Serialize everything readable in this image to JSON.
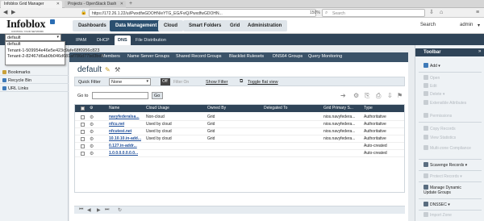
{
  "browser": {
    "tabs": [
      {
        "label": "Infoblox Grid Manager"
      },
      {
        "label": "Projects - OpenStack Dash"
      }
    ],
    "url": "https://172.26.1.22/ui/PwxdfwGDOHN/eYTG_EG/FviQ/PwxdfwGDOHN...",
    "zoom": "150%",
    "search_placeholder": "Search"
  },
  "app": {
    "logo": "Infoblox",
    "logo_tagline": "CONTROL YOUR NETWORK",
    "main_tabs": [
      "Dashboards",
      "Data Management",
      "Cloud",
      "Smart Folders",
      "Grid",
      "Administration"
    ],
    "active_main_tab": "Data Management",
    "search_label": "Search",
    "user_label": "admin"
  },
  "subnav": {
    "tabs": [
      "IPAM",
      "DHCP",
      "DNS",
      "File Distribution"
    ],
    "active": "DNS"
  },
  "subnav2": {
    "tabs": [
      "Members",
      "Name Server Groups",
      "Shared Record Groups",
      "Blacklist Rulesets",
      "DNS64 Groups",
      "Query Monitoring"
    ]
  },
  "view_dropdown": {
    "selected": "default",
    "options": [
      "default",
      "Tenant-1-509954e46e5e423c9afe68f0956c823",
      "Tenant-2-82467d6ab0b046d681af786d77bd3bd5"
    ]
  },
  "left_panel": {
    "items": [
      "Bookmarks",
      "Recycle Bin",
      "URL Links"
    ]
  },
  "content": {
    "breadcrumb": "default",
    "quick_filter_label": "Quick Filter",
    "quick_filter_value": "None",
    "filter_off": "Off",
    "filter_on": "Filter On",
    "show_filter": "Show Filter",
    "toggle_flat": "Toggle flat view",
    "go_to_label": "Go to",
    "go_button": "Go"
  },
  "grid": {
    "columns": [
      "Name",
      "Cloud Usage",
      "Owned By",
      "Delegated To",
      "Grid Primary S...",
      "Type"
    ],
    "rows": [
      {
        "name": "navyfederalsa...",
        "cloud_usage": "Non-cloud",
        "owned_by": "Grid",
        "delegated_to": "",
        "grid_primary": "nios.navyfedera...",
        "type": "Authoritative"
      },
      {
        "name": "nfcu.net",
        "cloud_usage": "Used by cloud",
        "owned_by": "Grid",
        "delegated_to": "",
        "grid_primary": "nios.navyfedera...",
        "type": "Authoritative"
      },
      {
        "name": "nfcutest.net",
        "cloud_usage": "Used by cloud",
        "owned_by": "Grid",
        "delegated_to": "",
        "grid_primary": "nios.navyfedera...",
        "type": "Authoritative"
      },
      {
        "name": "10.10.10.in-add...",
        "cloud_usage": "Used by cloud",
        "owned_by": "Grid",
        "delegated_to": "",
        "grid_primary": "nios.navyfedera...",
        "type": "Authoritative"
      },
      {
        "name": "0.127.in-addr...",
        "cloud_usage": "",
        "owned_by": "",
        "delegated_to": "",
        "grid_primary": "",
        "type": "Auto-created"
      },
      {
        "name": "1.0.0.0.0.0.0.0...",
        "cloud_usage": "",
        "owned_by": "",
        "delegated_to": "",
        "grid_primary": "",
        "type": "Auto-created"
      }
    ]
  },
  "toolbar": {
    "title": "Toolbar",
    "items": [
      {
        "label": "Add",
        "enabled": true
      },
      {
        "label": "Open",
        "enabled": false
      },
      {
        "label": "Edit",
        "enabled": false
      },
      {
        "label": "Delete",
        "enabled": false
      },
      {
        "label": "Extensible Attributes",
        "enabled": false
      },
      {
        "label": "Permissions",
        "enabled": false
      },
      {
        "label": "Copy Records",
        "enabled": false
      },
      {
        "label": "View Statistics",
        "enabled": false
      },
      {
        "label": "Multi-zone Compliance",
        "enabled": false
      },
      {
        "label": "Scavenge Records",
        "enabled": true
      },
      {
        "label": "Protect Records",
        "enabled": false
      },
      {
        "label": "Manage Dynamic Update Groups",
        "enabled": true
      },
      {
        "label": "DNSSEC",
        "enabled": true
      },
      {
        "label": "Import Zone",
        "enabled": false
      }
    ]
  },
  "colors": {
    "accent_dark": "#2f4458",
    "active_tab": "#2b4f6f",
    "link": "#1f4f9a"
  }
}
